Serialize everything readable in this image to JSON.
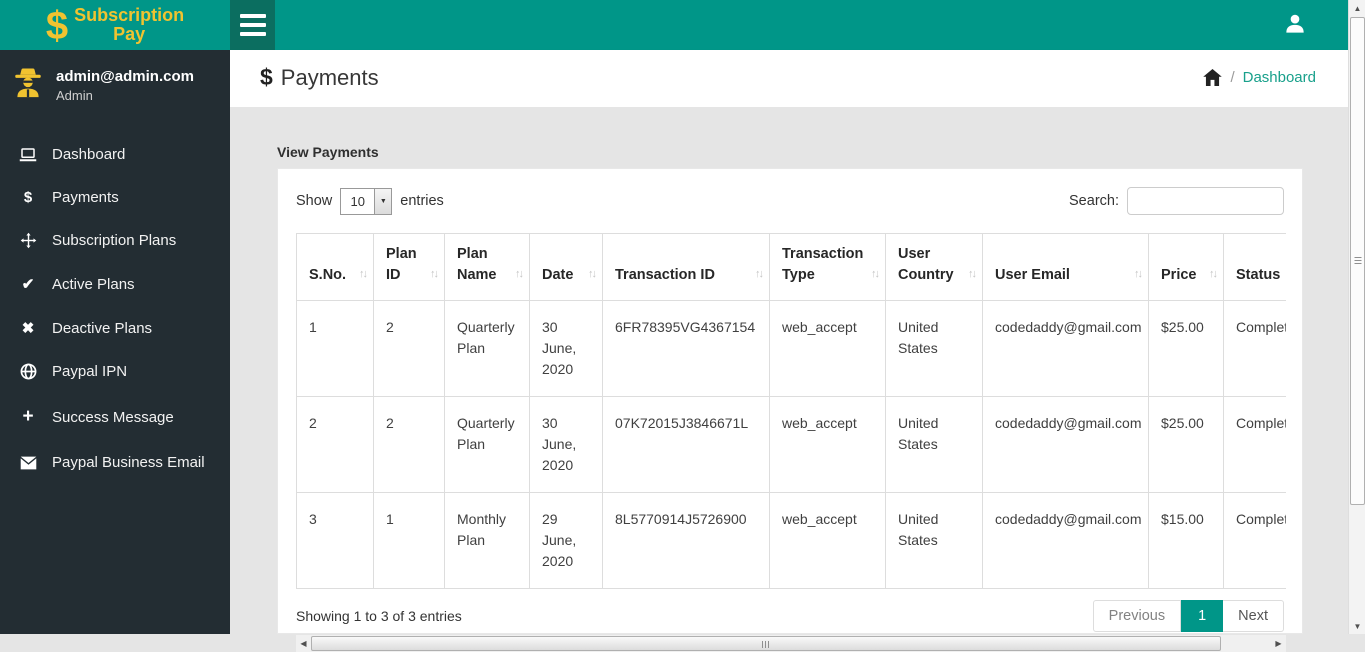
{
  "colors": {
    "accent_teal": "#009688",
    "hamburger_teal": "#0b6e60",
    "sidebar_dark": "#232d33",
    "brand_yellow": "#f0c330",
    "link_teal": "#18a08b",
    "content_gray": "#e5e5e5"
  },
  "brand": {
    "dollar": "$",
    "line1": "Subscription",
    "line2": "Pay"
  },
  "user": {
    "email": "admin@admin.com",
    "role": "Admin"
  },
  "sidebar": {
    "items": [
      {
        "label": "Dashboard",
        "icon": "laptop-icon"
      },
      {
        "label": "Payments",
        "icon": "dollar-icon",
        "glyph": "$"
      },
      {
        "label": "Subscription Plans",
        "icon": "move-icon"
      },
      {
        "label": "Active Plans",
        "icon": "check-icon",
        "glyph": "✔"
      },
      {
        "label": "Deactive Plans",
        "icon": "close-icon",
        "glyph": "✖"
      },
      {
        "label": "Paypal IPN",
        "icon": "globe-icon"
      },
      {
        "label": "Success Message",
        "icon": "plus-icon",
        "glyph": "+"
      },
      {
        "label": "Paypal Business Email",
        "icon": "envelope-icon"
      }
    ]
  },
  "page": {
    "title": "Payments",
    "title_icon": "$",
    "breadcrumb": {
      "separator": "/",
      "current": "Dashboard"
    }
  },
  "card": {
    "title": "View Payments",
    "length_control": {
      "prefix": "Show",
      "value": "10",
      "suffix": "entries"
    },
    "search": {
      "label": "Search:",
      "value": ""
    },
    "table": {
      "headers": [
        {
          "label": "S.No.",
          "sortable": true
        },
        {
          "label": "Plan ID",
          "sortable": true
        },
        {
          "label": "Plan Name",
          "sortable": true
        },
        {
          "label": "Date",
          "sortable": true
        },
        {
          "label": "Transaction ID",
          "sortable": true
        },
        {
          "label": "Transaction Type",
          "sortable": true
        },
        {
          "label": "User Country",
          "sortable": true
        },
        {
          "label": "User Email",
          "sortable": true
        },
        {
          "label": "Price",
          "sortable": true
        },
        {
          "label": "Status",
          "sortable": false
        }
      ],
      "rows": [
        {
          "sno": "1",
          "plan_id": "2",
          "plan_name": "Quarterly Plan",
          "date": "30 June, 2020",
          "txn_id": "6FR78395VG4367154",
          "txn_type": "web_accept",
          "country": "United States",
          "email": "codedaddy@gmail.com",
          "price": "$25.00",
          "status": "Completed"
        },
        {
          "sno": "2",
          "plan_id": "2",
          "plan_name": "Quarterly Plan",
          "date": "30 June, 2020",
          "txn_id": "07K72015J3846671L",
          "txn_type": "web_accept",
          "country": "United States",
          "email": "codedaddy@gmail.com",
          "price": "$25.00",
          "status": "Completed"
        },
        {
          "sno": "3",
          "plan_id": "1",
          "plan_name": "Monthly Plan",
          "date": "29 June, 2020",
          "txn_id": "8L5770914J5726900",
          "txn_type": "web_accept",
          "country": "United States",
          "email": "codedaddy@gmail.com",
          "price": "$15.00",
          "status": "Completed"
        }
      ]
    },
    "summary": "Showing 1 to 3 of 3 entries",
    "pagination": {
      "previous": "Previous",
      "page": "1",
      "next": "Next"
    }
  },
  "sort_glyph": "↑↓"
}
